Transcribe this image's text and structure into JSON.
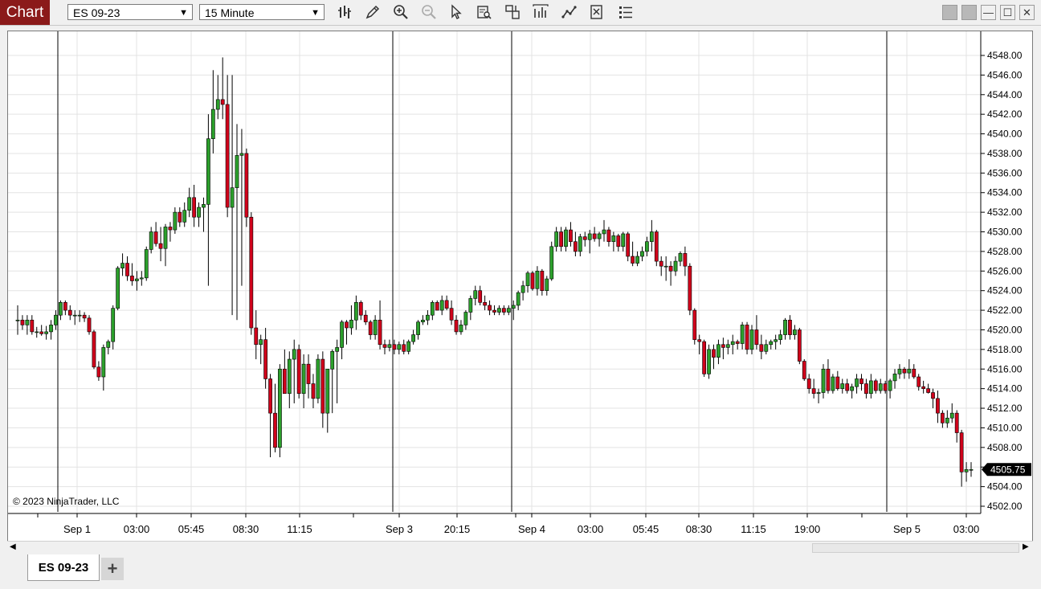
{
  "app": {
    "title": "Chart"
  },
  "toolbar": {
    "instrument": "ES 09-23",
    "interval": "15 Minute",
    "icons": [
      "bars-type-icon",
      "draw-pencil-icon",
      "zoom-in-icon",
      "zoom-out-icon",
      "pointer-icon",
      "data-box-icon",
      "templates-icon",
      "indicators-icon",
      "strategies-icon",
      "properties-icon",
      "object-list-icon"
    ]
  },
  "copyright": "© 2023 NinjaTrader, LLC",
  "tabs": {
    "active": "ES 09-23",
    "add": "+"
  },
  "chart_data": {
    "type": "candlestick",
    "title": "",
    "instrument": "ES 09-23",
    "interval": "15 Minute",
    "current_price": "4505.75",
    "y_ticks": [
      "4548.00",
      "4546.00",
      "4544.00",
      "4542.00",
      "4540.00",
      "4538.00",
      "4536.00",
      "4534.00",
      "4532.00",
      "4530.00",
      "4528.00",
      "4526.00",
      "4524.00",
      "4522.00",
      "4520.00",
      "4518.00",
      "4516.00",
      "4514.00",
      "4512.00",
      "4510.00",
      "4508.00",
      "4506.00",
      "4504.00",
      "4502.00"
    ],
    "ylim": [
      4501,
      4550
    ],
    "x_ticks": [
      "Sep 1",
      "03:00",
      "05:45",
      "08:30",
      "11:15",
      "Sep 3",
      "20:15",
      "Sep 4",
      "03:00",
      "05:45",
      "08:30",
      "11:15",
      "19:00",
      "Sep 5",
      "03:00"
    ],
    "colors": {
      "up": "#2ca02c",
      "down": "#d0021b",
      "wick": "#000000",
      "price_marker": "#000000"
    },
    "candles": [
      [
        4521.0,
        4522.5,
        4519.5,
        4521.0
      ],
      [
        4521.0,
        4521.5,
        4520.0,
        4520.5
      ],
      [
        4520.5,
        4521.5,
        4519.5,
        4521.0
      ],
      [
        4521.0,
        4521.5,
        4519.5,
        4519.8
      ],
      [
        4519.8,
        4520.3,
        4519.2,
        4519.8
      ],
      [
        4519.8,
        4520.5,
        4519.4,
        4519.6
      ],
      [
        4519.6,
        4520.4,
        4519.0,
        4519.8
      ],
      [
        4519.8,
        4521.0,
        4519.0,
        4520.5
      ],
      [
        4520.5,
        4522.0,
        4520.0,
        4521.5
      ],
      [
        4521.5,
        4523.0,
        4521.0,
        4522.8
      ],
      [
        4522.8,
        4523.0,
        4521.5,
        4522.0
      ],
      [
        4522.0,
        4522.5,
        4521.0,
        4521.5
      ],
      [
        4521.5,
        4522.0,
        4520.5,
        4521.5
      ],
      [
        4521.5,
        4522.0,
        4520.8,
        4521.5
      ],
      [
        4521.5,
        4521.8,
        4520.8,
        4521.2
      ],
      [
        4521.2,
        4521.5,
        4519.5,
        4519.8
      ],
      [
        4519.8,
        4520.0,
        4516.0,
        4516.2
      ],
      [
        4516.2,
        4516.8,
        4514.8,
        4515.2
      ],
      [
        4515.2,
        4518.5,
        4513.8,
        4518.2
      ],
      [
        4518.2,
        4519.0,
        4517.5,
        4518.8
      ],
      [
        4518.8,
        4522.5,
        4518.0,
        4522.2
      ],
      [
        4522.2,
        4526.5,
        4522.0,
        4526.3
      ],
      [
        4526.3,
        4527.8,
        4525.5,
        4526.8
      ],
      [
        4526.8,
        4527.5,
        4525.0,
        4525.5
      ],
      [
        4525.5,
        4526.8,
        4524.5,
        4525.0
      ],
      [
        4525.0,
        4526.0,
        4524.0,
        4525.2
      ],
      [
        4525.2,
        4526.0,
        4524.5,
        4525.3
      ],
      [
        4525.3,
        4528.5,
        4525.0,
        4528.2
      ],
      [
        4528.2,
        4530.5,
        4527.8,
        4530.0
      ],
      [
        4530.0,
        4531.0,
        4528.5,
        4528.8
      ],
      [
        4528.8,
        4530.5,
        4527.0,
        4528.3
      ],
      [
        4528.3,
        4530.8,
        4526.5,
        4530.5
      ],
      [
        4530.5,
        4531.0,
        4529.0,
        4530.2
      ],
      [
        4530.2,
        4532.5,
        4529.8,
        4532.0
      ],
      [
        4532.0,
        4532.5,
        4530.5,
        4531.0
      ],
      [
        4531.0,
        4533.0,
        4530.5,
        4532.2
      ],
      [
        4532.2,
        4534.5,
        4531.5,
        4533.5
      ],
      [
        4533.5,
        4534.8,
        4530.5,
        4531.5
      ],
      [
        4531.5,
        4533.0,
        4530.5,
        4532.5
      ],
      [
        4532.5,
        4533.5,
        4530.0,
        4532.8
      ],
      [
        4532.8,
        4542.0,
        4524.5,
        4539.5
      ],
      [
        4539.5,
        4546.5,
        4538.0,
        4542.5
      ],
      [
        4542.5,
        4546.0,
        4541.5,
        4543.5
      ],
      [
        4543.5,
        4547.8,
        4541.5,
        4543.0
      ],
      [
        4543.0,
        4546.0,
        4531.5,
        4532.5
      ],
      [
        4532.5,
        4546.0,
        4521.5,
        4534.5
      ],
      [
        4534.5,
        4541.0,
        4521.0,
        4537.8
      ],
      [
        4537.8,
        4540.5,
        4524.5,
        4538.0
      ],
      [
        4538.0,
        4538.5,
        4530.5,
        4531.5
      ],
      [
        4531.5,
        4532.0,
        4519.5,
        4520.2
      ],
      [
        4520.2,
        4522.0,
        4517.0,
        4518.5
      ],
      [
        4518.5,
        4519.5,
        4516.5,
        4519.0
      ],
      [
        4519.0,
        4520.2,
        4514.0,
        4515.0
      ],
      [
        4515.0,
        4515.5,
        4507.0,
        4511.5
      ],
      [
        4511.5,
        4514.5,
        4507.5,
        4508.0
      ],
      [
        4508.0,
        4516.5,
        4507.0,
        4516.0
      ],
      [
        4516.0,
        4518.0,
        4513.5,
        4513.5
      ],
      [
        4513.5,
        4517.8,
        4512.0,
        4517.0
      ],
      [
        4517.0,
        4519.0,
        4512.5,
        4518.0
      ],
      [
        4518.0,
        4518.5,
        4513.0,
        4513.5
      ],
      [
        4513.5,
        4517.5,
        4512.0,
        4516.5
      ],
      [
        4516.5,
        4517.5,
        4513.0,
        4514.5
      ],
      [
        4514.5,
        4515.5,
        4512.0,
        4513.0
      ],
      [
        4513.0,
        4517.5,
        4512.5,
        4517.0
      ],
      [
        4517.0,
        4517.8,
        4510.0,
        4511.5
      ],
      [
        4511.5,
        4515.5,
        4509.5,
        4516.0
      ],
      [
        4516.0,
        4518.0,
        4511.5,
        4517.8
      ],
      [
        4517.8,
        4519.0,
        4512.5,
        4518.2
      ],
      [
        4518.2,
        4521.0,
        4517.0,
        4520.8
      ],
      [
        4520.8,
        4521.0,
        4518.5,
        4520.2
      ],
      [
        4520.2,
        4522.5,
        4519.5,
        4521.0
      ],
      [
        4521.0,
        4523.5,
        4520.0,
        4522.8
      ],
      [
        4522.8,
        4523.0,
        4521.0,
        4521.5
      ],
      [
        4521.5,
        4522.0,
        4520.5,
        4520.8
      ],
      [
        4520.8,
        4521.0,
        4519.0,
        4519.5
      ],
      [
        4519.5,
        4521.5,
        4519.0,
        4521.0
      ],
      [
        4521.0,
        4523.0,
        4518.0,
        4518.5
      ],
      [
        4518.5,
        4519.0,
        4517.5,
        4518.2
      ],
      [
        4518.2,
        4519.0,
        4517.8,
        4518.5
      ],
      [
        4518.5,
        4519.0,
        4517.5,
        4518.0
      ],
      [
        4518.0,
        4518.8,
        4517.5,
        4518.5
      ],
      [
        4518.5,
        4519.0,
        4517.5,
        4517.8
      ],
      [
        4517.8,
        4519.0,
        4517.5,
        4518.8
      ],
      [
        4518.8,
        4520.0,
        4518.5,
        4519.5
      ],
      [
        4519.5,
        4521.0,
        4519.0,
        4520.8
      ],
      [
        4520.8,
        4521.5,
        4520.5,
        4521.0
      ],
      [
        4521.0,
        4522.0,
        4520.5,
        4521.5
      ],
      [
        4521.5,
        4523.0,
        4521.0,
        4522.8
      ],
      [
        4522.8,
        4523.0,
        4522.0,
        4522.0
      ],
      [
        4522.0,
        4523.5,
        4521.5,
        4523.0
      ],
      [
        4523.0,
        4523.5,
        4522.0,
        4522.2
      ],
      [
        4522.2,
        4523.0,
        4520.5,
        4521.0
      ],
      [
        4521.0,
        4521.5,
        4519.5,
        4519.8
      ],
      [
        4519.8,
        4521.0,
        4519.5,
        4520.5
      ],
      [
        4520.5,
        4522.0,
        4520.0,
        4521.8
      ],
      [
        4521.8,
        4523.5,
        4521.0,
        4523.2
      ],
      [
        4523.2,
        4524.5,
        4522.5,
        4524.0
      ],
      [
        4524.0,
        4524.5,
        4522.5,
        4522.8
      ],
      [
        4522.8,
        4523.5,
        4522.0,
        4522.5
      ],
      [
        4522.5,
        4523.0,
        4521.5,
        4522.0
      ],
      [
        4522.0,
        4522.5,
        4521.5,
        4521.8
      ],
      [
        4521.8,
        4522.5,
        4521.5,
        4522.2
      ],
      [
        4522.2,
        4522.5,
        4521.5,
        4521.8
      ],
      [
        4521.8,
        4522.5,
        4521.5,
        4522.2
      ],
      [
        4522.2,
        4523.0,
        4521.0,
        4522.5
      ],
      [
        4522.5,
        4524.0,
        4522.0,
        4523.8
      ],
      [
        4523.8,
        4525.0,
        4523.0,
        4524.5
      ],
      [
        4524.5,
        4526.0,
        4523.8,
        4525.8
      ],
      [
        4525.8,
        4526.0,
        4524.0,
        4524.2
      ],
      [
        4524.2,
        4526.5,
        4523.5,
        4526.0
      ],
      [
        4526.0,
        4526.2,
        4523.5,
        4524.0
      ],
      [
        4524.0,
        4525.5,
        4523.5,
        4525.2
      ],
      [
        4525.2,
        4529.0,
        4525.0,
        4528.5
      ],
      [
        4528.5,
        4530.5,
        4528.0,
        4530.0
      ],
      [
        4530.0,
        4530.5,
        4528.0,
        4528.5
      ],
      [
        4528.5,
        4530.5,
        4528.0,
        4530.2
      ],
      [
        4530.2,
        4531.0,
        4528.5,
        4529.0
      ],
      [
        4529.0,
        4530.0,
        4527.5,
        4528.0
      ],
      [
        4528.0,
        4529.8,
        4527.5,
        4529.5
      ],
      [
        4529.5,
        4530.0,
        4528.5,
        4529.2
      ],
      [
        4529.2,
        4530.2,
        4527.8,
        4529.8
      ],
      [
        4529.8,
        4530.5,
        4529.0,
        4529.3
      ],
      [
        4529.3,
        4530.0,
        4528.5,
        4529.8
      ],
      [
        4529.8,
        4531.2,
        4529.0,
        4530.2
      ],
      [
        4530.2,
        4530.5,
        4528.5,
        4529.0
      ],
      [
        4529.0,
        4530.0,
        4528.0,
        4529.6
      ],
      [
        4529.6,
        4529.8,
        4528.0,
        4528.5
      ],
      [
        4528.5,
        4530.0,
        4528.0,
        4529.8
      ],
      [
        4529.8,
        4530.0,
        4527.0,
        4527.5
      ],
      [
        4527.5,
        4529.0,
        4526.5,
        4526.8
      ],
      [
        4526.8,
        4528.0,
        4526.5,
        4527.5
      ],
      [
        4527.5,
        4528.5,
        4527.0,
        4528.0
      ],
      [
        4528.0,
        4529.5,
        4527.5,
        4529.0
      ],
      [
        4529.0,
        4531.2,
        4528.0,
        4530.0
      ],
      [
        4530.0,
        4530.2,
        4526.5,
        4527.0
      ],
      [
        4527.0,
        4527.5,
        4525.5,
        4526.5
      ],
      [
        4526.5,
        4527.5,
        4525.0,
        4526.5
      ],
      [
        4526.5,
        4527.0,
        4524.5,
        4526.0
      ],
      [
        4526.0,
        4527.5,
        4525.5,
        4527.0
      ],
      [
        4527.0,
        4528.0,
        4526.5,
        4527.8
      ],
      [
        4527.8,
        4528.5,
        4525.5,
        4526.5
      ],
      [
        4526.5,
        4526.8,
        4521.5,
        4522.0
      ],
      [
        4522.0,
        4522.2,
        4518.5,
        4519.0
      ],
      [
        4519.0,
        4519.5,
        4517.5,
        4518.8
      ],
      [
        4518.8,
        4519.0,
        4515.2,
        4515.5
      ],
      [
        4515.5,
        4518.5,
        4515.0,
        4518.0
      ],
      [
        4518.0,
        4518.5,
        4516.0,
        4517.2
      ],
      [
        4517.2,
        4519.0,
        4516.5,
        4518.5
      ],
      [
        4518.5,
        4519.2,
        4517.0,
        4518.2
      ],
      [
        4518.2,
        4519.0,
        4517.5,
        4518.5
      ],
      [
        4518.5,
        4519.5,
        4517.5,
        4518.8
      ],
      [
        4518.8,
        4519.0,
        4518.0,
        4518.6
      ],
      [
        4518.6,
        4520.8,
        4518.0,
        4520.5
      ],
      [
        4520.5,
        4520.8,
        4517.5,
        4518.0
      ],
      [
        4518.0,
        4520.5,
        4517.5,
        4520.0
      ],
      [
        4520.0,
        4521.5,
        4518.0,
        4518.5
      ],
      [
        4518.5,
        4519.5,
        4517.0,
        4517.8
      ],
      [
        4517.8,
        4519.0,
        4517.5,
        4518.5
      ],
      [
        4518.5,
        4519.0,
        4518.0,
        4518.8
      ],
      [
        4518.8,
        4519.5,
        4518.0,
        4519.0
      ],
      [
        4519.0,
        4520.0,
        4518.5,
        4519.5
      ],
      [
        4519.5,
        4521.2,
        4519.0,
        4521.0
      ],
      [
        4521.0,
        4521.5,
        4519.0,
        4519.5
      ],
      [
        4519.5,
        4520.5,
        4519.0,
        4520.0
      ],
      [
        4520.0,
        4520.2,
        4516.5,
        4516.8
      ],
      [
        4516.8,
        4517.0,
        4514.8,
        4515.0
      ],
      [
        4515.0,
        4515.5,
        4513.5,
        4514.0
      ],
      [
        4514.0,
        4515.0,
        4513.0,
        4513.5
      ],
      [
        4513.5,
        4514.0,
        4512.5,
        4513.6
      ],
      [
        4513.6,
        4516.5,
        4513.0,
        4516.0
      ],
      [
        4516.0,
        4517.0,
        4513.5,
        4513.8
      ],
      [
        4513.8,
        4515.5,
        4513.5,
        4515.2
      ],
      [
        4515.2,
        4515.8,
        4513.8,
        4514.0
      ],
      [
        4514.0,
        4515.0,
        4513.5,
        4514.5
      ],
      [
        4514.5,
        4515.0,
        4513.5,
        4513.8
      ],
      [
        4513.8,
        4514.5,
        4513.0,
        4514.2
      ],
      [
        4514.2,
        4515.5,
        4513.5,
        4515.0
      ],
      [
        4515.0,
        4515.5,
        4513.8,
        4514.5
      ],
      [
        4514.5,
        4515.0,
        4513.0,
        4513.5
      ],
      [
        4513.5,
        4515.5,
        4513.0,
        4514.8
      ],
      [
        4514.8,
        4515.0,
        4513.5,
        4513.8
      ],
      [
        4513.8,
        4515.0,
        4513.5,
        4514.5
      ],
      [
        4514.5,
        4514.8,
        4513.5,
        4513.8
      ],
      [
        4513.8,
        4515.0,
        4513.0,
        4514.8
      ],
      [
        4514.8,
        4516.0,
        4514.0,
        4515.5
      ],
      [
        4515.5,
        4516.5,
        4515.0,
        4516.0
      ],
      [
        4516.0,
        4516.2,
        4515.0,
        4515.6
      ],
      [
        4515.6,
        4517.0,
        4515.0,
        4516.0
      ],
      [
        4516.0,
        4516.5,
        4515.0,
        4515.2
      ],
      [
        4515.2,
        4515.5,
        4513.8,
        4514.2
      ],
      [
        4514.2,
        4514.8,
        4513.5,
        4514.0
      ],
      [
        4514.0,
        4514.5,
        4513.5,
        4513.6
      ],
      [
        4513.6,
        4514.0,
        4512.0,
        4513.0
      ],
      [
        4513.0,
        4513.8,
        4510.5,
        4511.5
      ],
      [
        4511.5,
        4511.8,
        4510.0,
        4510.5
      ],
      [
        4510.5,
        4511.8,
        4510.0,
        4511.0
      ],
      [
        4511.0,
        4512.5,
        4510.5,
        4511.5
      ],
      [
        4511.5,
        4511.8,
        4508.5,
        4509.5
      ],
      [
        4509.5,
        4509.8,
        4504.0,
        4505.5
      ],
      [
        4505.5,
        4506.5,
        4504.5,
        4505.75
      ],
      [
        4505.75,
        4506.5,
        4505.0,
        4505.75
      ]
    ]
  }
}
